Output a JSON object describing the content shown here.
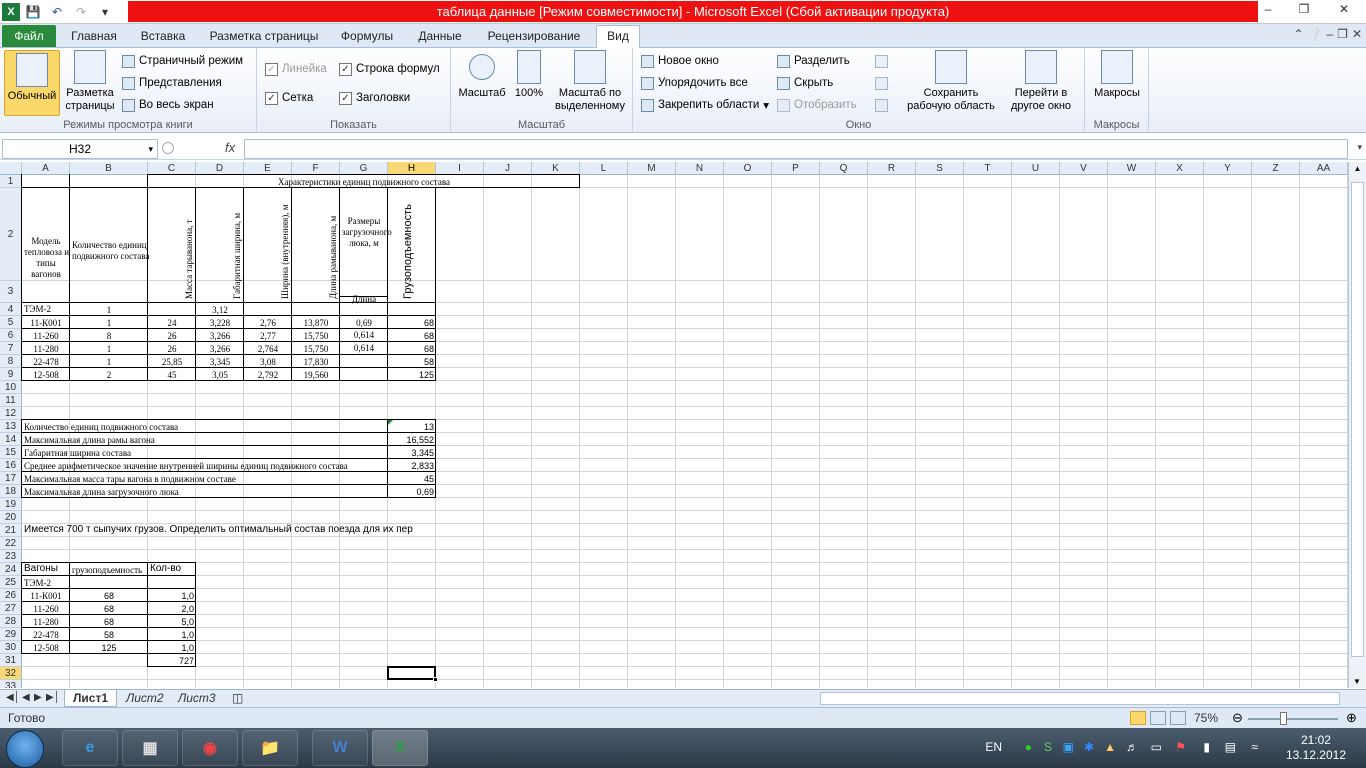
{
  "window": {
    "title": "таблица данные  [Режим совместимости]  -  Microsoft Excel (Сбой активации продукта)",
    "minimize_icon": "minimize-icon",
    "restore_icon": "restore-icon",
    "close_icon": "close-icon"
  },
  "ribbon_tabs": [
    "Файл",
    "Главная",
    "Вставка",
    "Разметка страницы",
    "Формулы",
    "Данные",
    "Рецензирование",
    "Вид"
  ],
  "ribbon": {
    "views": {
      "normal": "Обычный",
      "page_layout_1": "Разметка",
      "page_layout_2": "страницы",
      "page_break": "Страничный режим",
      "custom_views": "Представления",
      "full_screen": "Во весь экран",
      "group": "Режимы просмотра книги"
    },
    "show": {
      "ruler": "Линейка",
      "formula_bar": "Строка формул",
      "gridlines": "Сетка",
      "headings": "Заголовки",
      "group": "Показать"
    },
    "zoom": {
      "zoom": "Масштаб",
      "zoom100": "100%",
      "zoom_sel_1": "Масштаб по",
      "zoom_sel_2": "выделенному",
      "group": "Масштаб"
    },
    "window": {
      "new_window": "Новое окно",
      "arrange_all": "Упорядочить все",
      "freeze": "Закрепить области",
      "split": "Разделить",
      "hide": "Скрыть",
      "unhide": "Отобразить",
      "save_ws_1": "Сохранить",
      "save_ws_2": "рабочую область",
      "switch_1": "Перейти в",
      "switch_2": "другое окно",
      "group": "Окно"
    },
    "macros": {
      "macros": "Макросы",
      "group": "Макросы"
    }
  },
  "formula_bar": {
    "name_box": "H32",
    "fx": "fx",
    "content": ""
  },
  "columns": [
    "A",
    "B",
    "C",
    "D",
    "E",
    "F",
    "G",
    "H",
    "I",
    "J",
    "K",
    "L",
    "M",
    "N",
    "O",
    "P",
    "Q",
    "R",
    "S",
    "T",
    "U",
    "V",
    "W",
    "X",
    "Y",
    "Z",
    "AA"
  ],
  "selected_column": "H",
  "selected_row": "32",
  "rows": [
    "1",
    "2",
    "3",
    "4",
    "5",
    "6",
    "7",
    "8",
    "9",
    "10",
    "11",
    "12",
    "13",
    "14",
    "15",
    "16",
    "17",
    "18",
    "19",
    "20",
    "21",
    "22",
    "23",
    "24",
    "25",
    "26",
    "27",
    "28",
    "29",
    "30",
    "31",
    "32",
    "33"
  ],
  "sheet": {
    "header_char": "Характеристики единиц подвижного состава",
    "h_model": [
      "Модель",
      "тепловоза и",
      "типы",
      "вагонов"
    ],
    "h_count": [
      "Количество единиц",
      "подвижного состава"
    ],
    "h_mass": "Масса тарыванона, т",
    "h_width": "Габаритная ширина, м",
    "h_inner": "Ширина (внутренняя), м",
    "h_length": "Длина рамыванона, м",
    "h_hatch": [
      "Размеры",
      "загрузочного",
      "люка, м"
    ],
    "h_hatch_len": "Длина",
    "h_capacity": "Грузоподъемность",
    "data_rows": [
      {
        "a": "ТЭМ-2",
        "b": "1",
        "c": "",
        "d": "3,12",
        "e": "",
        "f": "",
        "g": "",
        "h": ""
      },
      {
        "a": "11-К001",
        "b": "1",
        "c": "24",
        "d": "3,228",
        "e": "2,76",
        "f": "13,870",
        "g": "0,69",
        "h": "68"
      },
      {
        "a": "11-260",
        "b": "8",
        "c": "26",
        "d": "3,266",
        "e": "2,77",
        "f": "15,750",
        "g": "0,614",
        "h": "68"
      },
      {
        "a": "11-280",
        "b": "1",
        "c": "26",
        "d": "3,266",
        "e": "2,764",
        "f": "15,750",
        "g": "0,614",
        "h": "68"
      },
      {
        "a": "22-478",
        "b": "1",
        "c": "25,85",
        "d": "3,345",
        "e": "3,08",
        "f": "17,830",
        "g": "",
        "h": "58"
      },
      {
        "a": "12-508",
        "b": "2",
        "c": "45",
        "d": "3,05",
        "e": "2,792",
        "f": "19,560",
        "g": "",
        "h": "125"
      }
    ],
    "summary": [
      {
        "label": "Количество единиц подвижного состава",
        "value": "13"
      },
      {
        "label": "Максимальная длина рамы вагона",
        "value": "16,552"
      },
      {
        "label": "Габаритная ширина состава",
        "value": "3,345"
      },
      {
        "label": "Среднее арифметическое значение внутренней ширины единиц подвижного состава",
        "value": "2,833"
      },
      {
        "label": "Максимальная масса тары вагона в подвижном составе",
        "value": "45"
      },
      {
        "label": "Максимальная длина загрузочного люка",
        "value": "0,69"
      }
    ],
    "task_text": "Имеется 700 т сыпучих грузов. Определить оптимальный состав поезда для их пер",
    "t2_headers": [
      "Вагоны",
      "грузоподъемность",
      "Кол-во"
    ],
    "t2_rows": [
      {
        "a": "ТЭМ-2",
        "b": "",
        "c": ""
      },
      {
        "a": "11-К001",
        "b": "68",
        "c": "1,0"
      },
      {
        "a": "11-260",
        "b": "68",
        "c": "2,0"
      },
      {
        "a": "11-280",
        "b": "68",
        "c": "5,0"
      },
      {
        "a": "22-478",
        "b": "58",
        "c": "1,0"
      },
      {
        "a": "12-508",
        "b": "125",
        "c": "1,0"
      }
    ],
    "t2_total": "727"
  },
  "sheet_tabs": [
    "Лист1",
    "Лист2",
    "Лист3"
  ],
  "status": {
    "ready": "Готово",
    "zoom": "75%"
  },
  "taskbar": {
    "lang": "EN",
    "time": "21:02",
    "date": "13.12.2012"
  }
}
